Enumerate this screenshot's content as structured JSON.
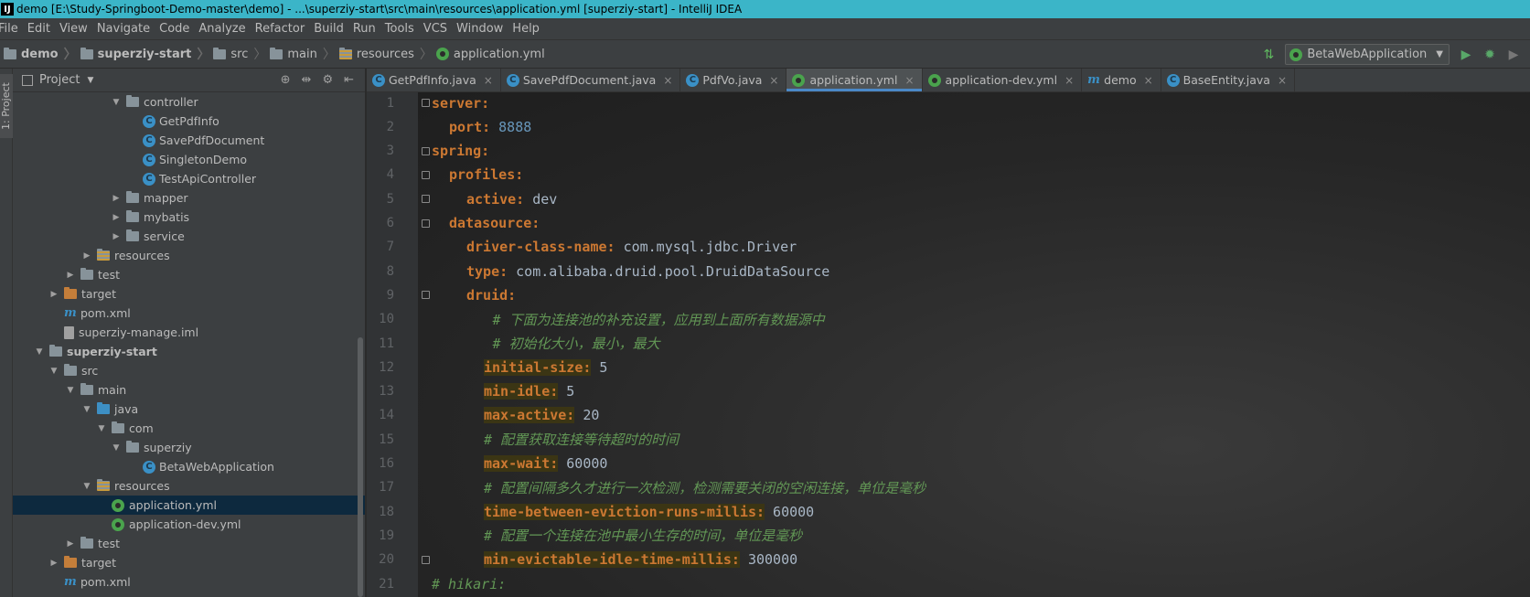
{
  "window": {
    "title": "demo [E:\\Study-Springboot-Demo-master\\demo] - ...\\superziy-start\\src\\main\\resources\\application.yml [superziy-start] - IntelliJ IDEA"
  },
  "menu": [
    "File",
    "Edit",
    "View",
    "Navigate",
    "Code",
    "Analyze",
    "Refactor",
    "Build",
    "Run",
    "Tools",
    "VCS",
    "Window",
    "Help"
  ],
  "breadcrumbs": [
    "demo",
    "superziy-start",
    "src",
    "main",
    "resources",
    "application.yml"
  ],
  "run_config": {
    "label": "BetaWebApplication"
  },
  "left_stripe": {
    "label": "1: Project"
  },
  "project_panel": {
    "title": "Project",
    "tree": [
      {
        "label": "controller",
        "type": "folder",
        "level": 6,
        "expanded": true
      },
      {
        "label": "GetPdfInfo",
        "type": "class",
        "level": 7
      },
      {
        "label": "SavePdfDocument",
        "type": "class",
        "level": 7
      },
      {
        "label": "SingletonDemo",
        "type": "class",
        "level": 7
      },
      {
        "label": "TestApiController",
        "type": "class",
        "level": 7
      },
      {
        "label": "mapper",
        "type": "folder",
        "level": 6,
        "expanded": false
      },
      {
        "label": "mybatis",
        "type": "folder",
        "level": 6,
        "expanded": false
      },
      {
        "label": "service",
        "type": "folder",
        "level": 6,
        "expanded": false
      },
      {
        "label": "resources",
        "type": "res-folder",
        "level": 4,
        "expanded": false
      },
      {
        "label": "test",
        "type": "folder",
        "level": 3,
        "expanded": false
      },
      {
        "label": "target",
        "type": "orange-folder",
        "level": 2,
        "expanded": false
      },
      {
        "label": "pom.xml",
        "type": "maven",
        "level": 2
      },
      {
        "label": "superziy-manage.iml",
        "type": "file",
        "level": 2
      },
      {
        "label": "superziy-start",
        "type": "module",
        "level": 1,
        "expanded": true,
        "bold": true
      },
      {
        "label": "src",
        "type": "folder",
        "level": 2,
        "expanded": true
      },
      {
        "label": "main",
        "type": "folder",
        "level": 3,
        "expanded": true
      },
      {
        "label": "java",
        "type": "blue-folder",
        "level": 4,
        "expanded": true
      },
      {
        "label": "com",
        "type": "folder",
        "level": 5,
        "expanded": true
      },
      {
        "label": "superziy",
        "type": "folder",
        "level": 6,
        "expanded": true
      },
      {
        "label": "BetaWebApplication",
        "type": "class",
        "level": 7
      },
      {
        "label": "resources",
        "type": "res-folder",
        "level": 4,
        "expanded": true
      },
      {
        "label": "application.yml",
        "type": "yml",
        "level": 5,
        "selected": true
      },
      {
        "label": "application-dev.yml",
        "type": "yml",
        "level": 5
      },
      {
        "label": "test",
        "type": "folder",
        "level": 3,
        "expanded": false
      },
      {
        "label": "target",
        "type": "orange-folder",
        "level": 2,
        "expanded": false
      },
      {
        "label": "pom.xml",
        "type": "maven",
        "level": 2
      }
    ]
  },
  "tabs": [
    {
      "label": "GetPdfInfo.java",
      "icon": "class"
    },
    {
      "label": "SavePdfDocument.java",
      "icon": "class"
    },
    {
      "label": "PdfVo.java",
      "icon": "class"
    },
    {
      "label": "application.yml",
      "icon": "yml",
      "active": true
    },
    {
      "label": "application-dev.yml",
      "icon": "yml"
    },
    {
      "label": "demo",
      "icon": "maven"
    },
    {
      "label": "BaseEntity.java",
      "icon": "class"
    }
  ],
  "code_lines": [
    {
      "n": "1",
      "indent": 0,
      "key": "server:",
      "val": "",
      "valType": "",
      "fold": true
    },
    {
      "n": "2",
      "indent": 1,
      "key": "port:",
      "val": "8888",
      "valType": "num"
    },
    {
      "n": "3",
      "indent": 0,
      "key": "spring:",
      "val": "",
      "valType": "",
      "fold": true
    },
    {
      "n": "4",
      "indent": 1,
      "key": "profiles:",
      "val": "",
      "valType": "",
      "fold": true
    },
    {
      "n": "5",
      "indent": 2,
      "key": "active:",
      "val": "dev",
      "valType": "str",
      "fold": true
    },
    {
      "n": "6",
      "indent": 1,
      "key": "datasource:",
      "val": "",
      "valType": "",
      "fold": true
    },
    {
      "n": "7",
      "indent": 2,
      "key": "driver-class-name:",
      "val": "com.mysql.jdbc.Driver",
      "valType": "str"
    },
    {
      "n": "8",
      "indent": 2,
      "key": "type:",
      "val": "com.alibaba.druid.pool.DruidDataSource",
      "valType": "str"
    },
    {
      "n": "9",
      "indent": 2,
      "key": "druid:",
      "val": "",
      "valType": "",
      "fold": true
    },
    {
      "n": "10",
      "indent": 3.5,
      "comment": "# 下面为连接池的补充设置，应用到上面所有数据源中"
    },
    {
      "n": "11",
      "indent": 3.5,
      "comment": "# 初始化大小，最小，最大"
    },
    {
      "n": "12",
      "indent": 3,
      "key": "initial-size:",
      "val": "5",
      "valType": "str",
      "hl": true
    },
    {
      "n": "13",
      "indent": 3,
      "key": "min-idle:",
      "val": "5",
      "valType": "str",
      "hl": true
    },
    {
      "n": "14",
      "indent": 3,
      "key": "max-active:",
      "val": "20",
      "valType": "str",
      "hl": true
    },
    {
      "n": "15",
      "indent": 3,
      "comment": "# 配置获取连接等待超时的时间"
    },
    {
      "n": "16",
      "indent": 3,
      "key": "max-wait:",
      "val": "60000",
      "valType": "str",
      "hl": true
    },
    {
      "n": "17",
      "indent": 3,
      "comment": "# 配置间隔多久才进行一次检测，检测需要关闭的空闲连接，单位是毫秒"
    },
    {
      "n": "18",
      "indent": 3,
      "key": "time-between-eviction-runs-millis:",
      "val": "60000",
      "valType": "str",
      "hl": true
    },
    {
      "n": "19",
      "indent": 3,
      "comment": "# 配置一个连接在池中最小生存的时间，单位是毫秒"
    },
    {
      "n": "20",
      "indent": 3,
      "key": "min-evictable-idle-time-millis:",
      "val": "300000",
      "valType": "str",
      "hl": true,
      "fold": true
    },
    {
      "n": "21",
      "indent": 0,
      "comment": "#  hikari:"
    }
  ]
}
